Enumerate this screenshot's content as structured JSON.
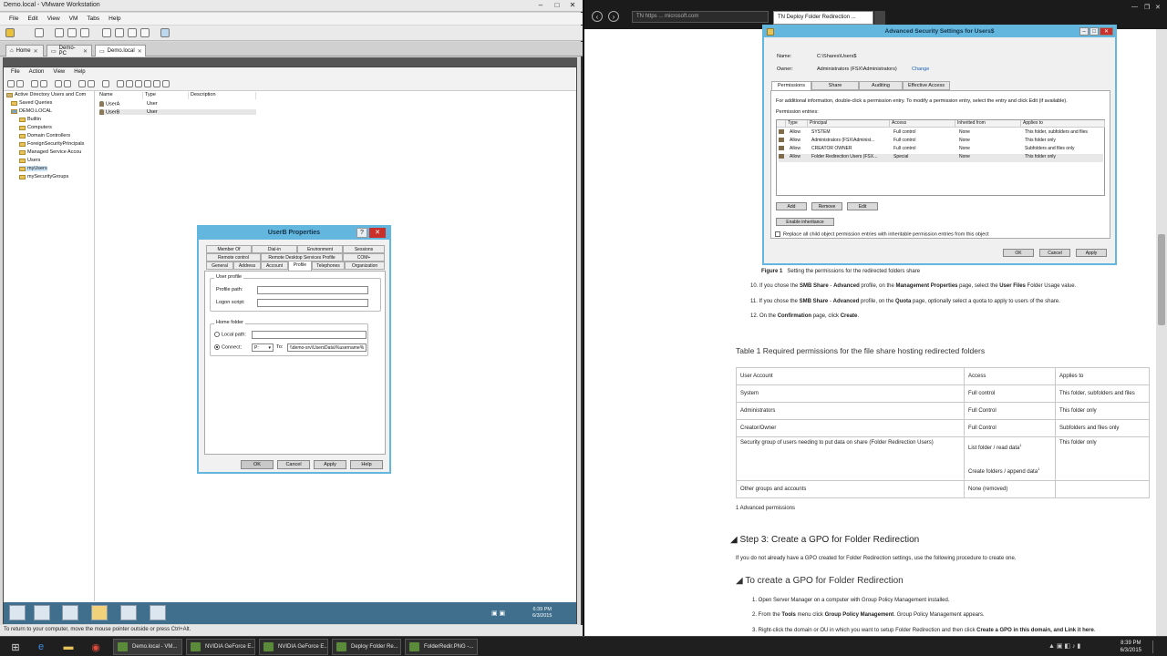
{
  "vmware": {
    "title": "Demo.local - VMware Workstation",
    "menu": [
      "File",
      "Edit",
      "View",
      "VM",
      "Tabs",
      "Help"
    ],
    "tabs": [
      "Home",
      "Demo-PC",
      "Demo.local"
    ],
    "status": "To return to your computer, move the mouse pointer outside or press Ctrl+Alt."
  },
  "aduc": {
    "menu": [
      "File",
      "Action",
      "View",
      "Help"
    ],
    "tree": [
      "Active Directory Users and Com",
      "Saved Queries",
      "DEMO.LOCAL",
      "Builtin",
      "Computers",
      "Domain Controllers",
      "ForeignSecurityPrincipals",
      "Managed Service Accou",
      "Users",
      "myUsers",
      "mySecurityGroups"
    ],
    "columns": [
      "Name",
      "Type",
      "Description"
    ],
    "rows": [
      [
        "UserA",
        "User",
        ""
      ],
      [
        "UserB",
        "User",
        ""
      ]
    ],
    "clock": {
      "time": "6:39 PM",
      "date": "6/3/2015"
    }
  },
  "dialog": {
    "title": "UserB Properties",
    "help": "?",
    "close": "✕",
    "tabs_row1": [
      "Member Of",
      "Dial-in",
      "Environment",
      "Sessions"
    ],
    "tabs_row2": [
      "Remote control",
      "Remote Desktop Services Profile",
      "COM+"
    ],
    "tabs_row3": [
      "General",
      "Address",
      "Account",
      "Profile",
      "Telephones",
      "Organization"
    ],
    "user_profile": "User profile",
    "profile_path": "Profile path:",
    "logon_script": "Logon script:",
    "home_folder": "Home folder",
    "local_path": "Local path:",
    "connect": "Connect:",
    "drive": "P:",
    "to": "To:",
    "to_value": "\\\\demo-srv\\UsersData\\%username%",
    "buttons": [
      "OK",
      "Cancel",
      "Apply",
      "Help"
    ]
  },
  "browser": {
    "address": "TN https ... microsoft.com",
    "tab": "TN Deploy Folder Redirection ..."
  },
  "adv": {
    "title": "Advanced Security Settings for Users$",
    "name_label": "Name:",
    "name_value": "C:\\Shares\\Users$",
    "owner_label": "Owner:",
    "owner_value": "Administrators (FSX\\Administrators)",
    "change": "Change",
    "tabs": [
      "Permissions",
      "Share",
      "Auditing",
      "Effective Access"
    ],
    "info": "For additional information, double-click a permission entry. To modify a permission entry, select the entry and click Edit (if available).",
    "entries_label": "Permission entries:",
    "columns": [
      "Type",
      "Principal",
      "Access",
      "Inherited from",
      "Applies to"
    ],
    "rows": [
      [
        "Allow",
        "SYSTEM",
        "Full control",
        "None",
        "This folder, subfolders and files"
      ],
      [
        "Allow",
        "Administrators (FSX\\Administ...",
        "Full control",
        "None",
        "This folder only"
      ],
      [
        "Allow",
        "CREATOR OWNER",
        "Full control",
        "None",
        "Subfolders and files only"
      ],
      [
        "Allow",
        "Folder Redirection Users (FSX...",
        "Special",
        "None",
        "This folder only"
      ]
    ],
    "buttons": [
      "Add",
      "Remove",
      "Edit"
    ],
    "enable_inheritance": "Enable inheritance",
    "replace": "Replace all child object permission entries with inheritable permission entries from this object",
    "footer": [
      "OK",
      "Cancel",
      "Apply"
    ]
  },
  "doc": {
    "figure_label": "Figure 1",
    "figure_caption": "Setting the permissions for the redirected folders share",
    "step10_a": "10.  If you chose the ",
    "step10_b1": "SMB Share",
    "step10_c": " - ",
    "step10_b2": "Advanced",
    "step10_d": " profile, on the ",
    "step10_b3": "Management Properties",
    "step10_e": " page, select the ",
    "step10_b4": "User Files",
    "step10_f": " Folder Usage value.",
    "step11_a": "11.  If you chose the ",
    "step11_b1": "SMB Share",
    "step11_c": " - ",
    "step11_b2": "Advanced",
    "step11_d": " profile, on the ",
    "step11_b3": "Quota",
    "step11_e": " page, optionally select a quota to apply to users of the share.",
    "step12_a": "12.  On the ",
    "step12_b1": "Confirmation",
    "step12_c": " page, click ",
    "step12_b2": "Create",
    "step12_d": ".",
    "table_title": "Table 1 Required permissions for the file share hosting redirected folders",
    "table": {
      "headers": [
        "User Account",
        "Access",
        "Applies to"
      ],
      "rows": [
        [
          "System",
          "Full control",
          "This folder, subfolders and files"
        ],
        [
          "Administrators",
          "Full Control",
          "This folder only"
        ],
        [
          "Creator/Owner",
          "Full Control",
          "Subfolders and files only"
        ],
        [
          "Security group of users needing to put data on share (Folder Redirection Users)",
          "List folder / read data",
          "This folder only"
        ],
        [
          "Other groups and accounts",
          "None (removed)",
          ""
        ]
      ],
      "extra_access": "Create folders / append data",
      "sup": "1"
    },
    "footnote": "1 Advanced permissions",
    "step3": "Step 3: Create a GPO for Folder Redirection",
    "step3_text": "If you do not already have a GPO created for Folder Redirection settings, use the following procedure to create one.",
    "to_create": "To create a GPO for Folder Redirection",
    "s1": "1.  Open Server Manager on a computer with Group Policy Management installed.",
    "s2_a": "2.  From the ",
    "s2_b1": "Tools",
    "s2_c": " menu click ",
    "s2_b2": "Group Policy Management",
    "s2_d": ". Group Policy Management appears.",
    "s3_a": "3.  Right-click the domain or OU in which you want to setup Folder Redirection and then click ",
    "s3_b": "Create a GPO in this domain, and Link it here",
    "s3_c": "."
  },
  "taskbar": {
    "apps": [
      "Demo.local - VM...",
      "NVIDIA GeForce E...",
      "NVIDIA GeForce E...",
      "Deploy Folder Re...",
      "FolderRedir.PNG -..."
    ],
    "time": "8:39 PM",
    "date": "6/3/2015"
  }
}
